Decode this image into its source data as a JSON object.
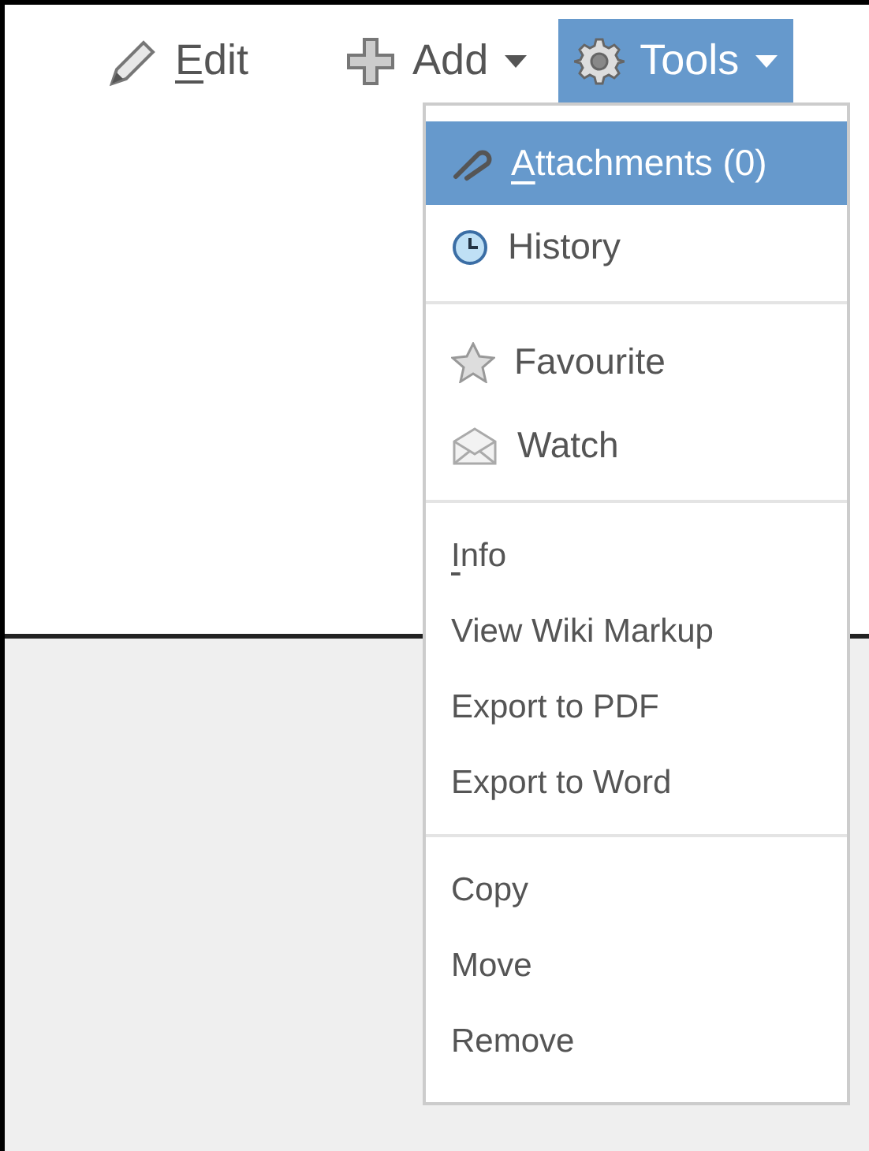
{
  "toolbar": [
    {
      "label": "Edit",
      "mnemonic": true,
      "dropdown": false,
      "selected": false
    },
    {
      "label": "Add",
      "mnemonic": false,
      "dropdown": true,
      "selected": false
    },
    {
      "label": "Tools",
      "mnemonic": false,
      "dropdown": true,
      "selected": true
    }
  ],
  "menu": {
    "sections": [
      {
        "kind": "icon",
        "items": [
          {
            "label": "Attachments (0)",
            "mnemonic": true,
            "selected": true
          },
          {
            "label": "History",
            "mnemonic": false,
            "selected": false
          }
        ]
      },
      {
        "kind": "icon",
        "items": [
          {
            "label": "Favourite",
            "mnemonic": false,
            "selected": false
          },
          {
            "label": "Watch",
            "mnemonic": false,
            "selected": false
          }
        ]
      },
      {
        "kind": "plain",
        "items": [
          {
            "label": "Info",
            "mnemonic": true,
            "selected": false
          },
          {
            "label": "View Wiki Markup",
            "mnemonic": false,
            "selected": false
          },
          {
            "label": "Export to PDF",
            "mnemonic": false,
            "selected": false
          },
          {
            "label": "Export to Word",
            "mnemonic": false,
            "selected": false
          }
        ]
      },
      {
        "kind": "plain",
        "items": [
          {
            "label": "Copy",
            "mnemonic": false,
            "selected": false
          },
          {
            "label": "Move",
            "mnemonic": false,
            "selected": false
          },
          {
            "label": "Remove",
            "mnemonic": false,
            "selected": false
          }
        ]
      }
    ]
  }
}
